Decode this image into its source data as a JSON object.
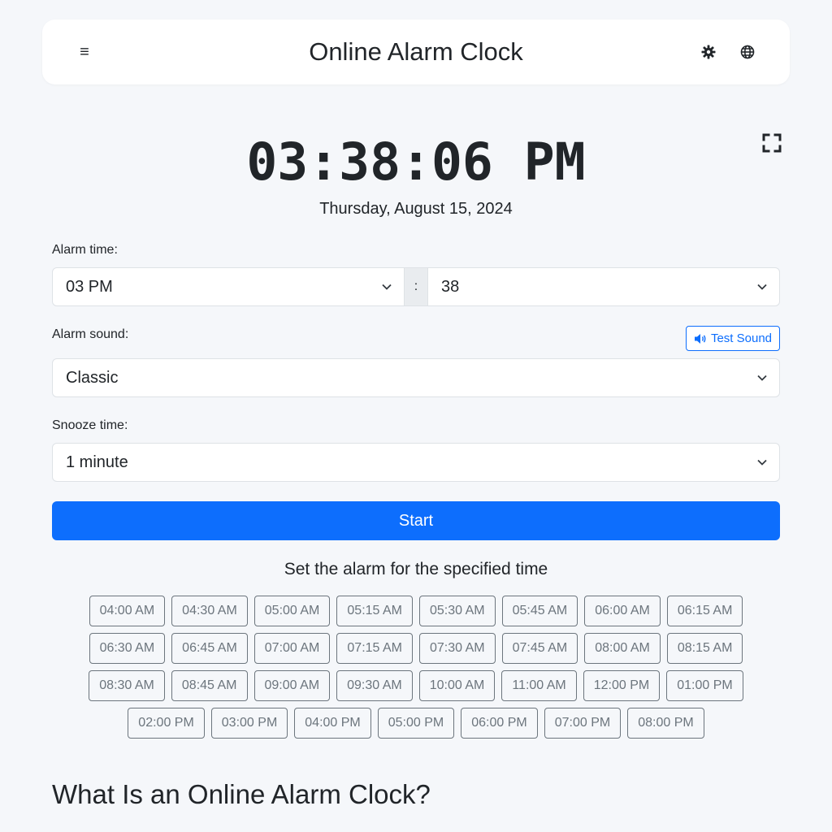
{
  "header": {
    "menu_glyph": "≡",
    "title": "Online Alarm Clock",
    "icons": [
      "gear-icon",
      "globe-icon"
    ]
  },
  "clock": {
    "time": "03:38:06 PM",
    "date": "Thursday, August 15, 2024",
    "fullscreen_icon": "fullscreen-icon"
  },
  "alarm": {
    "time_label": "Alarm time:",
    "hour_value": "03 PM",
    "separator": ":",
    "minute_value": "38",
    "sound_label": "Alarm sound:",
    "test_sound_label": "Test Sound",
    "sound_value": "Classic",
    "snooze_label": "Snooze time:",
    "snooze_value": "1 minute",
    "start_label": "Start"
  },
  "presets": {
    "title": "Set the alarm for the specified time",
    "rows": [
      [
        "04:00 AM",
        "04:30 AM",
        "05:00 AM",
        "05:15 AM",
        "05:30 AM",
        "05:45 AM",
        "06:00 AM",
        "06:15 AM"
      ],
      [
        "06:30 AM",
        "06:45 AM",
        "07:00 AM",
        "07:15 AM",
        "07:30 AM",
        "07:45 AM",
        "08:00 AM",
        "08:15 AM"
      ],
      [
        "08:30 AM",
        "08:45 AM",
        "09:00 AM",
        "09:30 AM",
        "10:00 AM",
        "11:00 AM",
        "12:00 PM",
        "01:00 PM"
      ],
      [
        "02:00 PM",
        "03:00 PM",
        "04:00 PM",
        "05:00 PM",
        "06:00 PM",
        "07:00 PM",
        "08:00 PM"
      ]
    ]
  },
  "section": {
    "heading": "What Is an Online Alarm Clock?"
  },
  "colors": {
    "primary": "#0d6efd",
    "background": "#f5f7fa",
    "secondary": "#6c757d"
  }
}
